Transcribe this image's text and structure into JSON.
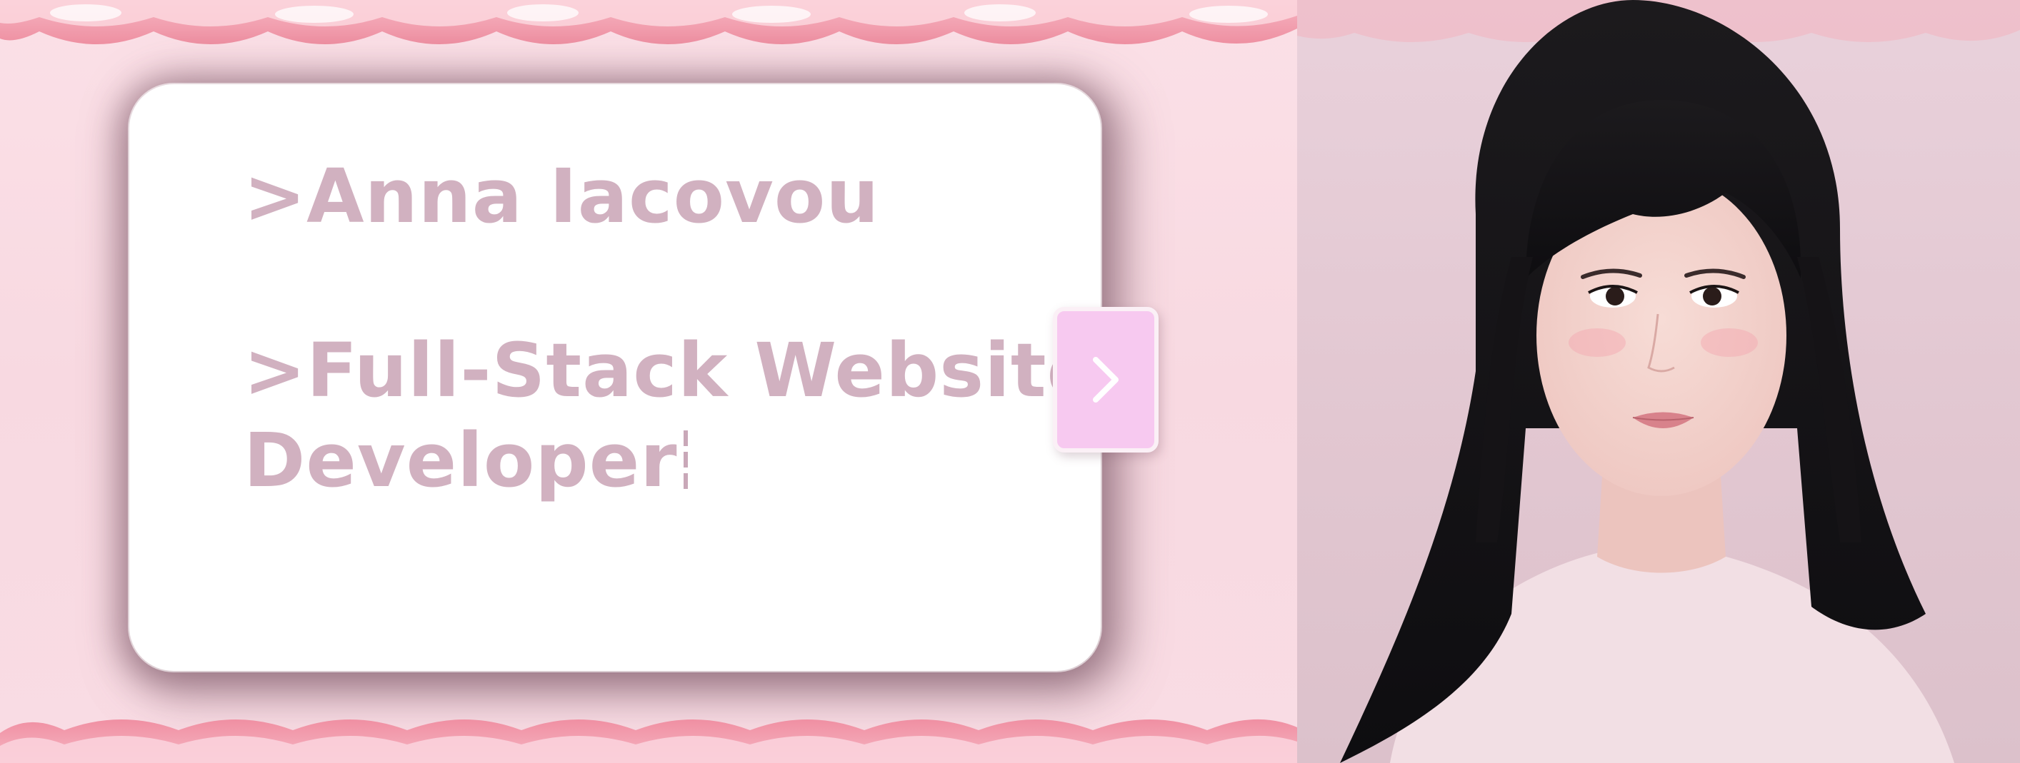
{
  "card": {
    "name": ">Anna Iacovou",
    "role_line1": ">Full-Stack Website",
    "role_line2": "Developer"
  },
  "next_button": {
    "icon": "chevron-right-icon",
    "aria_label": "next"
  },
  "portrait": {
    "alt": "Portrait photo"
  },
  "colors": {
    "background": "#fbe0e7",
    "text": "#d1b1c0",
    "card": "#ffffff",
    "button": "#f7c9f0",
    "scallop": "#f08fa2"
  }
}
